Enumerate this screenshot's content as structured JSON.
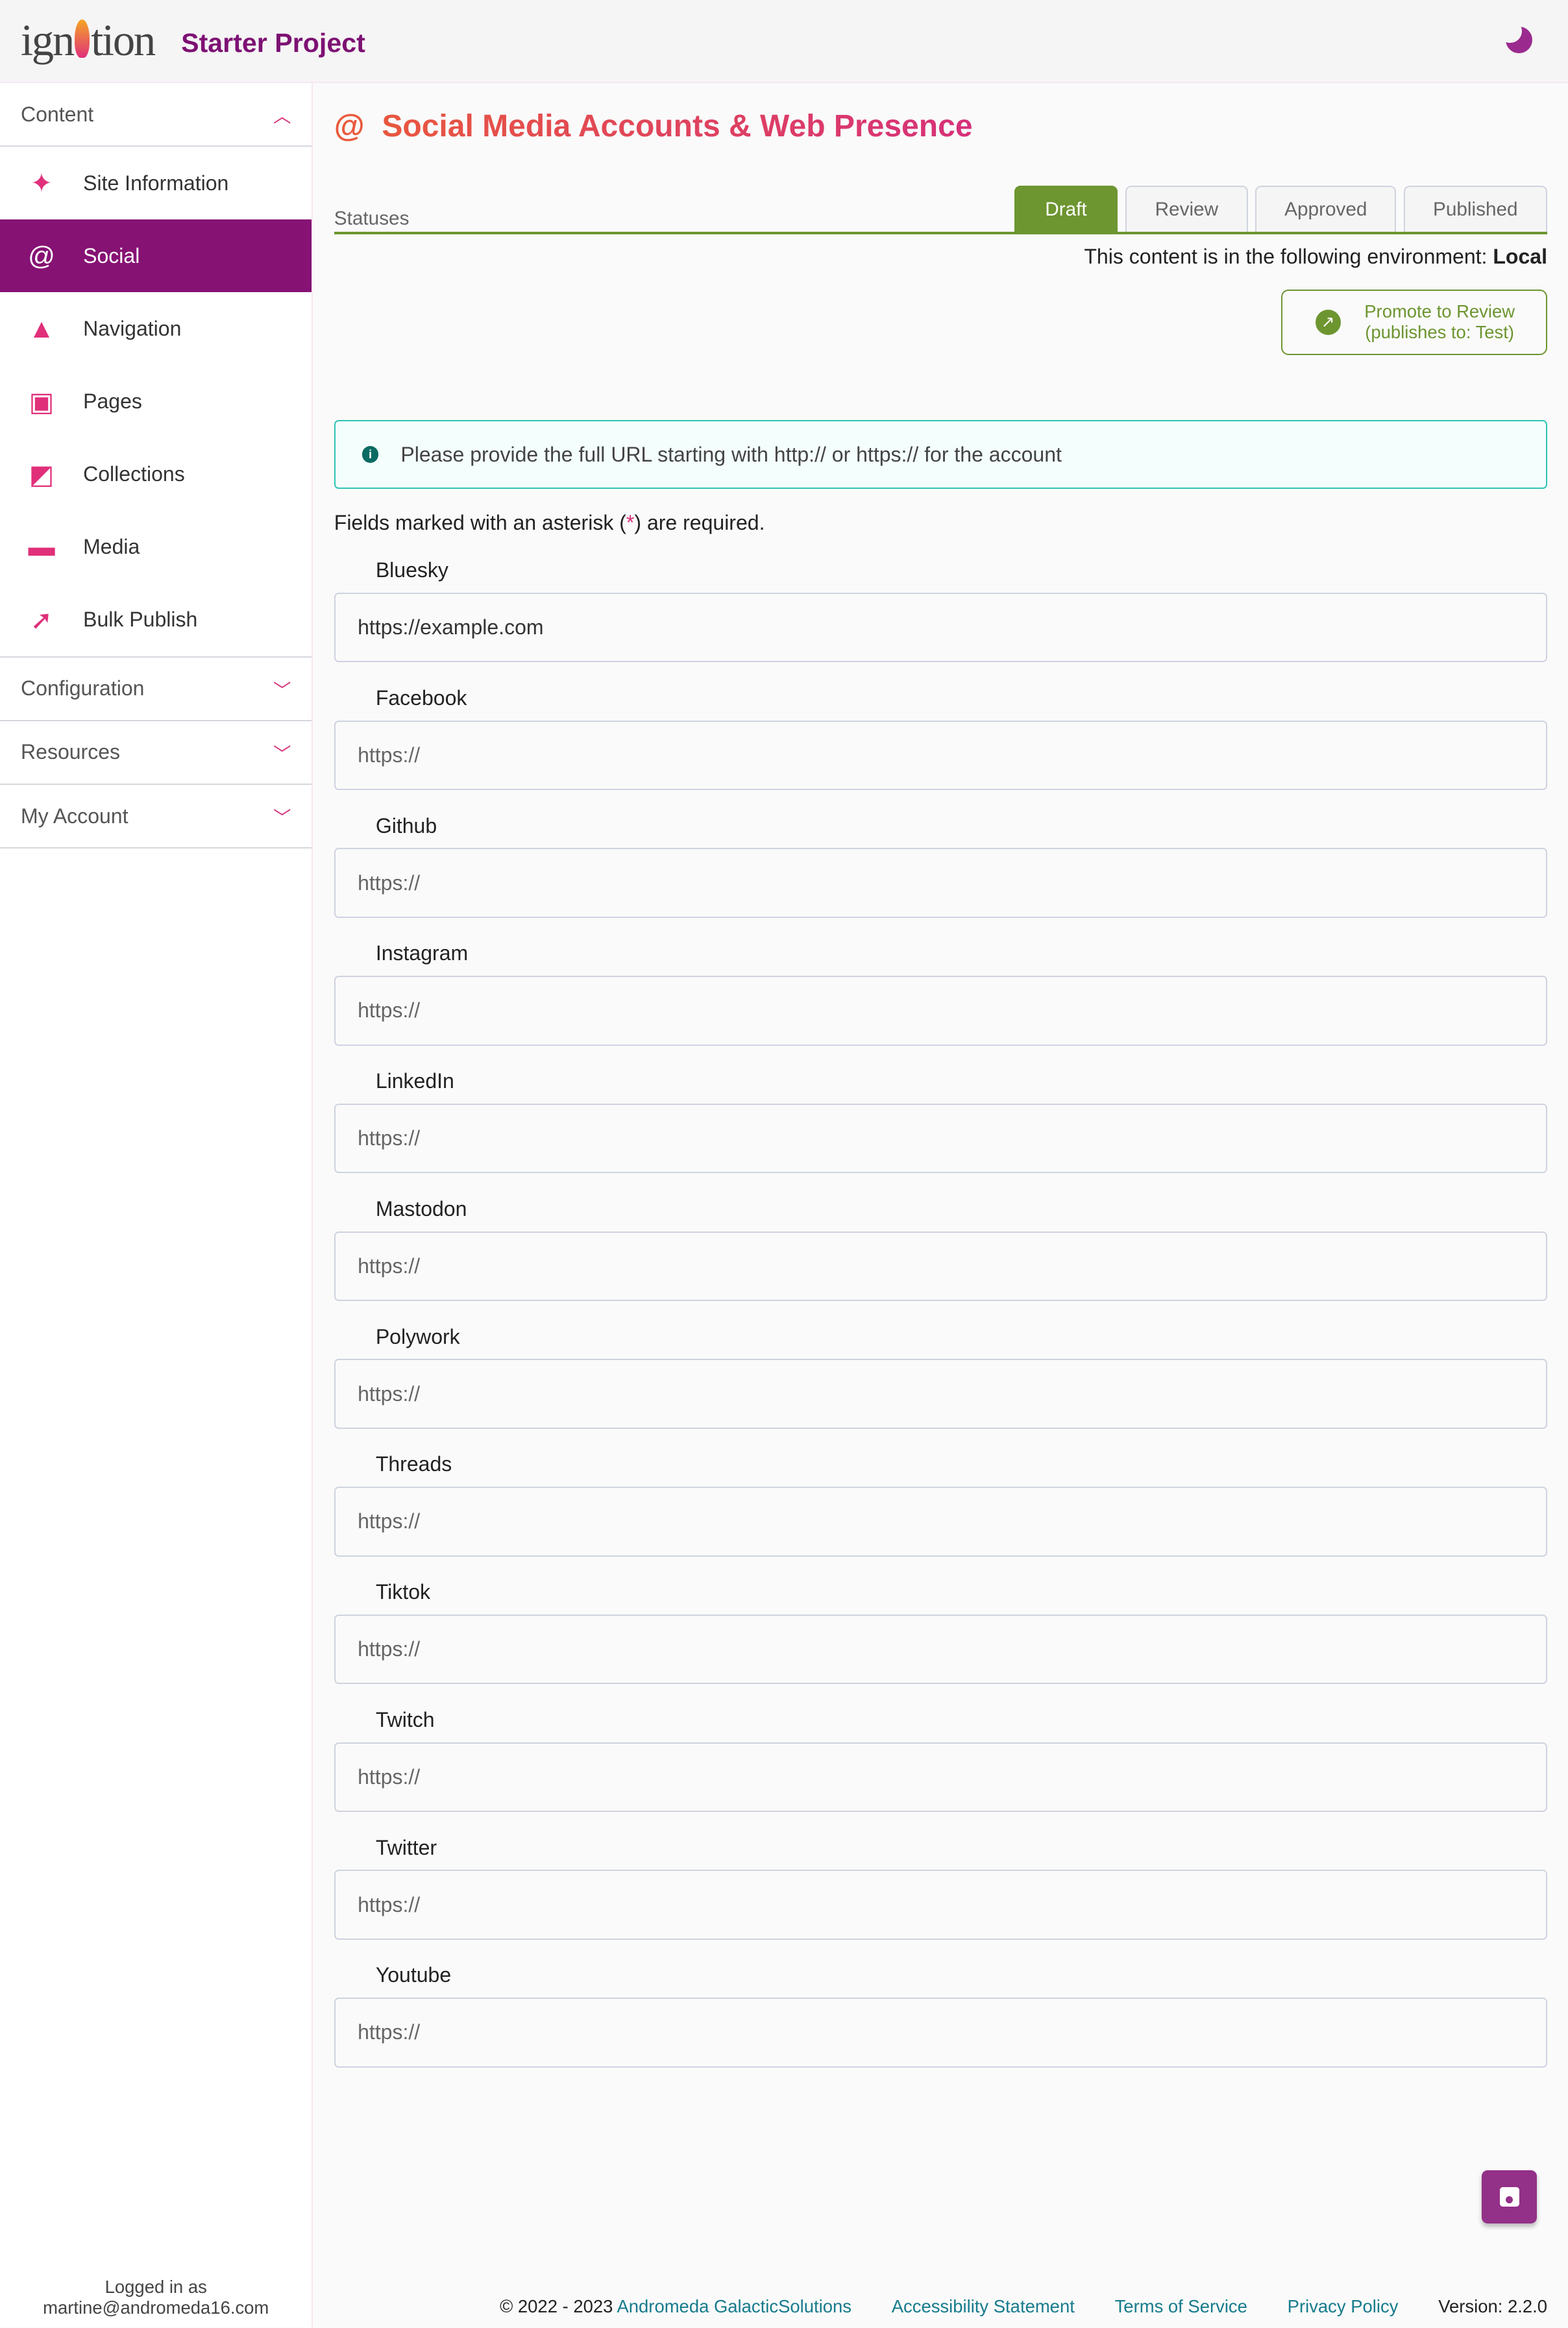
{
  "header": {
    "logo": "ignition",
    "project": "Starter Project",
    "theme_icon": "moon-icon"
  },
  "sidebar": {
    "content_label": "Content",
    "items": [
      {
        "label": "Site Information",
        "icon": "sparkles-icon"
      },
      {
        "label": "Social",
        "icon": "at-icon"
      },
      {
        "label": "Navigation",
        "icon": "navigation-arrow-icon"
      },
      {
        "label": "Pages",
        "icon": "pages-icon"
      },
      {
        "label": "Collections",
        "icon": "collections-icon"
      },
      {
        "label": "Media",
        "icon": "image-icon"
      },
      {
        "label": "Bulk Publish",
        "icon": "publish-arrow-icon"
      }
    ],
    "sections": [
      "Configuration",
      "Resources",
      "My Account"
    ],
    "logged_in_label": "Logged in as",
    "logged_in_user": "martine@andromeda16.com"
  },
  "main": {
    "title": "Social Media Accounts & Web Presence",
    "statuses_label": "Statuses",
    "tabs": [
      "Draft",
      "Review",
      "Approved",
      "Published"
    ],
    "env_text": "This content is in the following environment: ",
    "env_value": "Local",
    "promote_line1": "Promote to Review",
    "promote_line2": "(publishes to: Test)",
    "info": "Please provide the full URL starting with http:// or https:// for the account",
    "req_before": "Fields marked with an asterisk (",
    "req_ast": "*",
    "req_after": ") are required.",
    "placeholder": "https://",
    "fields": [
      {
        "label": "Bluesky",
        "value": "https://example.com"
      },
      {
        "label": "Facebook",
        "value": ""
      },
      {
        "label": "Github",
        "value": ""
      },
      {
        "label": "Instagram",
        "value": ""
      },
      {
        "label": "LinkedIn",
        "value": ""
      },
      {
        "label": "Mastodon",
        "value": ""
      },
      {
        "label": "Polywork",
        "value": ""
      },
      {
        "label": "Threads",
        "value": ""
      },
      {
        "label": "Tiktok",
        "value": ""
      },
      {
        "label": "Twitch",
        "value": ""
      },
      {
        "label": "Twitter",
        "value": ""
      },
      {
        "label": "Youtube",
        "value": ""
      }
    ]
  },
  "footer": {
    "copyright": "© 2022 - 2023 ",
    "company": "Andromeda GalacticSolutions",
    "links": [
      "Accessibility Statement",
      "Terms of Service",
      "Privacy Policy"
    ],
    "version": "Version: 2.2.0"
  },
  "colors": {
    "brand": "#861274",
    "accent": "#d6307a",
    "status": "#6d9530",
    "info": "#2ec4b6"
  }
}
